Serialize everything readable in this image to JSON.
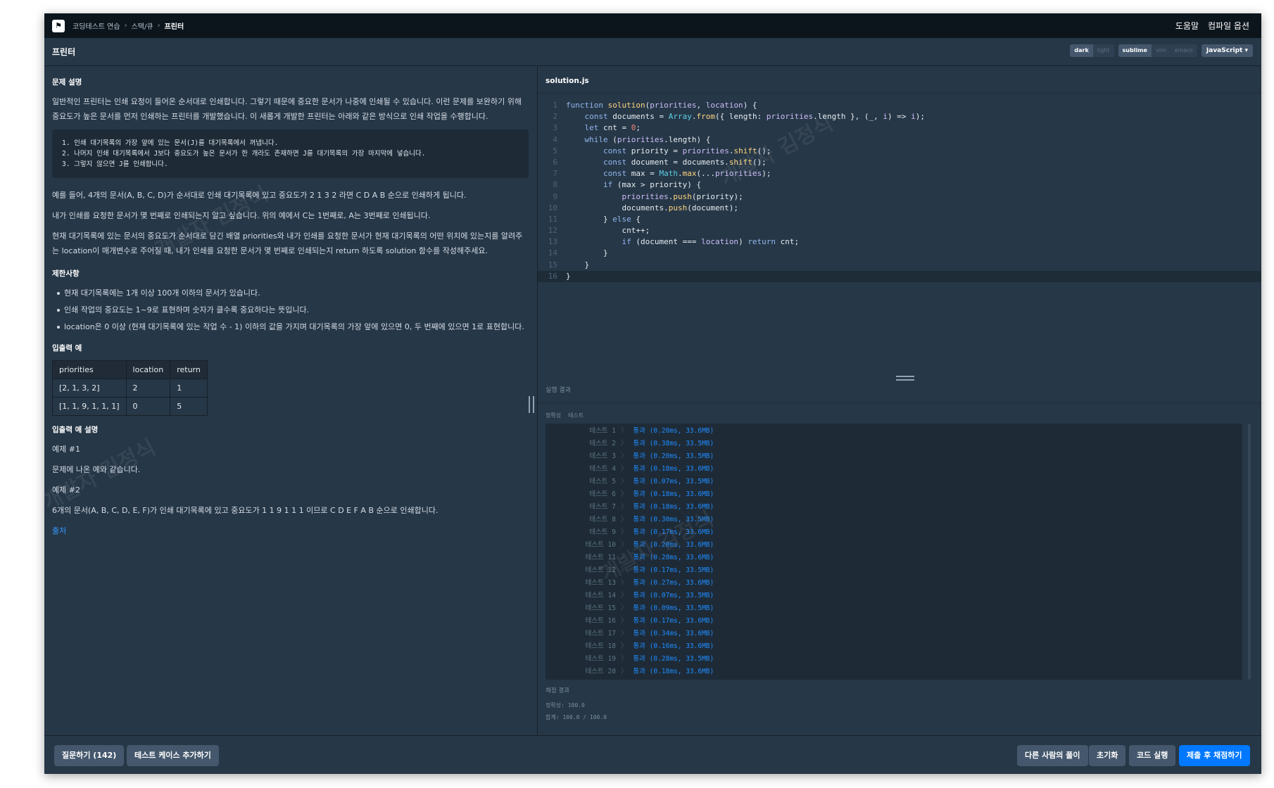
{
  "nav": {
    "logo_glyph": "⚑",
    "breadcrumb": [
      "코딩테스트 연습",
      "스택/큐",
      "프린터"
    ],
    "help": "도움말",
    "compile_options": "컴파일 옵션"
  },
  "title": "프린터",
  "editor_options": {
    "theme": [
      "dark",
      "light"
    ],
    "keymap": [
      "sublime",
      "vim",
      "emacs"
    ],
    "language": "JavaScript ▾"
  },
  "problem": {
    "heading": "문제 설명",
    "intro": "일반적인 프린터는 인쇄 요청이 들어온 순서대로 인쇄합니다. 그렇기 때문에 중요한 문서가 나중에 인쇄될 수 있습니다. 이런 문제를 보완하기 위해 중요도가 높은 문서를 먼저 인쇄하는 프린터를 개발했습니다. 이 새롭게 개발한 프린터는 아래와 같은 방식으로 인쇄 작업을 수행합니다.",
    "steps": [
      "1. 인쇄 대기목록의 가장 앞에 있는 문서(J)를 대기목록에서 꺼냅니다.",
      "2. 나머지 인쇄 대기목록에서 J보다 중요도가 높은 문서가 한 개라도 존재하면 J를 대기목록의 가장 마지막에 넣습니다.",
      "3. 그렇지 않으면 J를 인쇄합니다."
    ],
    "p1": "예를 들어, 4개의 문서(A, B, C, D)가 순서대로 인쇄 대기목록에 있고 중요도가 2 1 3 2 라면 C D A B 순으로 인쇄하게 됩니다.",
    "p2": "내가 인쇄를 요청한 문서가 몇 번째로 인쇄되는지 알고 싶습니다. 위의 예에서 C는 1번째로, A는 3번째로 인쇄됩니다.",
    "p3": "현재 대기목록에 있는 문서의 중요도가 순서대로 담긴 배열 priorities와 내가 인쇄를 요청한 문서가 현재 대기목록의 어떤 위치에 있는지를 알려주는 location이 매개변수로 주어질 때, 내가 인쇄를 요청한 문서가 몇 번째로 인쇄되는지 return 하도록 solution 함수를 작성해주세요.",
    "constraints_heading": "제한사항",
    "constraints": [
      "현재 대기목록에는 1개 이상 100개 이하의 문서가 있습니다.",
      "인쇄 작업의 중요도는 1~9로 표현하며 숫자가 클수록 중요하다는 뜻입니다.",
      "location은 0 이상 (현재 대기목록에 있는 작업 수 - 1) 이하의 값을 가지며 대기목록의 가장 앞에 있으면 0, 두 번째에 있으면 1로 표현합니다."
    ],
    "io_heading": "입출력 예",
    "io_table": {
      "headers": [
        "priorities",
        "location",
        "return"
      ],
      "rows": [
        [
          "[2, 1, 3, 2]",
          "2",
          "1"
        ],
        [
          "[1, 1, 9, 1, 1, 1]",
          "0",
          "5"
        ]
      ]
    },
    "io_desc_heading": "입출력 예 설명",
    "ex1_label": "예제 #1",
    "ex1_text": "문제에 나온 예와 같습니다.",
    "ex2_label": "예제 #2",
    "ex2_text": "6개의 문서(A, B, C, D, E, F)가 인쇄 대기목록에 있고 중요도가 1 1 9 1 1 1 이므로 C D E F A B 순으로 인쇄합니다.",
    "source_link": "출처",
    "watermark": "개발자 김정식"
  },
  "editor": {
    "filename": "solution.js",
    "lines": [
      [
        [
          "kw",
          "function "
        ],
        [
          "fn",
          "solution"
        ],
        [
          "tx",
          "("
        ],
        [
          "pm",
          "priorities"
        ],
        [
          "tx",
          ", "
        ],
        [
          "pm",
          "location"
        ],
        [
          "tx",
          ") {"
        ]
      ],
      [
        [
          "tx",
          "    "
        ],
        [
          "kw",
          "const "
        ],
        [
          "tx",
          "documents = "
        ],
        [
          "bi",
          "Array"
        ],
        [
          "tx",
          "."
        ],
        [
          "fn",
          "from"
        ],
        [
          "tx",
          "({ length: "
        ],
        [
          "pm",
          "priorities"
        ],
        [
          "tx",
          ".length }, (_, "
        ],
        [
          "pm",
          "i"
        ],
        [
          "tx",
          ") => "
        ],
        [
          "pm",
          "i"
        ],
        [
          "tx",
          ");"
        ]
      ],
      [
        [
          "tx",
          "    "
        ],
        [
          "kw",
          "let "
        ],
        [
          "tx",
          "cnt = "
        ],
        [
          "num",
          "0"
        ],
        [
          "tx",
          ";"
        ]
      ],
      [
        [
          "tx",
          "    "
        ],
        [
          "kw",
          "while "
        ],
        [
          "tx",
          "("
        ],
        [
          "pm",
          "priorities"
        ],
        [
          "tx",
          ".length) {"
        ]
      ],
      [
        [
          "tx",
          "        "
        ],
        [
          "kw",
          "const "
        ],
        [
          "tx",
          "priority = "
        ],
        [
          "pm",
          "priorities"
        ],
        [
          "tx",
          "."
        ],
        [
          "fn",
          "shift"
        ],
        [
          "tx",
          "();"
        ]
      ],
      [
        [
          "tx",
          "        "
        ],
        [
          "kw",
          "const "
        ],
        [
          "tx",
          "document = documents."
        ],
        [
          "fn",
          "shift"
        ],
        [
          "tx",
          "();"
        ]
      ],
      [
        [
          "tx",
          "        "
        ],
        [
          "kw",
          "const "
        ],
        [
          "tx",
          "max = "
        ],
        [
          "bi",
          "Math"
        ],
        [
          "tx",
          "."
        ],
        [
          "fn",
          "max"
        ],
        [
          "tx",
          "(..."
        ],
        [
          "pm",
          "priorities"
        ],
        [
          "tx",
          ");"
        ]
      ],
      [
        [
          "tx",
          "        "
        ],
        [
          "kw",
          "if "
        ],
        [
          "tx",
          "(max > priority) {"
        ]
      ],
      [
        [
          "tx",
          "            "
        ],
        [
          "pm",
          "priorities"
        ],
        [
          "tx",
          "."
        ],
        [
          "fn",
          "push"
        ],
        [
          "tx",
          "(priority);"
        ]
      ],
      [
        [
          "tx",
          "            documents."
        ],
        [
          "fn",
          "push"
        ],
        [
          "tx",
          "(document);"
        ]
      ],
      [
        [
          "tx",
          "        } "
        ],
        [
          "kw",
          "else "
        ],
        [
          "tx",
          "{"
        ]
      ],
      [
        [
          "tx",
          "            cnt++;"
        ]
      ],
      [
        [
          "tx",
          "            "
        ],
        [
          "kw",
          "if "
        ],
        [
          "tx",
          "(document === "
        ],
        [
          "pm",
          "location"
        ],
        [
          "tx",
          ") "
        ],
        [
          "kw",
          "return "
        ],
        [
          "tx",
          "cnt;"
        ]
      ],
      [
        [
          "tx",
          "        }"
        ]
      ],
      [
        [
          "tx",
          "    }"
        ]
      ],
      [
        [
          "tx",
          "}"
        ]
      ]
    ]
  },
  "results": {
    "heading": "실행 결과",
    "tabs": [
      "정확성",
      "테스트"
    ],
    "tests": [
      {
        "name": "테스트 1",
        "result": "통과 (0.20ms, 33.6MB)"
      },
      {
        "name": "테스트 2",
        "result": "통과 (0.38ms, 33.5MB)"
      },
      {
        "name": "테스트 3",
        "result": "통과 (0.20ms, 33.5MB)"
      },
      {
        "name": "테스트 4",
        "result": "통과 (0.18ms, 33.6MB)"
      },
      {
        "name": "테스트 5",
        "result": "통과 (0.07ms, 33.5MB)"
      },
      {
        "name": "테스트 6",
        "result": "통과 (0.18ms, 33.6MB)"
      },
      {
        "name": "테스트 7",
        "result": "통과 (0.18ms, 33.6MB)"
      },
      {
        "name": "테스트 8",
        "result": "통과 (0.30ms, 33.5MB)"
      },
      {
        "name": "테스트 9",
        "result": "통과 (0.17ms, 33.6MB)"
      },
      {
        "name": "테스트 10",
        "result": "통과 (0.20ms, 33.6MB)"
      },
      {
        "name": "테스트 11",
        "result": "통과 (0.28ms, 33.6MB)"
      },
      {
        "name": "테스트 12",
        "result": "통과 (0.17ms, 33.5MB)"
      },
      {
        "name": "테스트 13",
        "result": "통과 (0.27ms, 33.6MB)"
      },
      {
        "name": "테스트 14",
        "result": "통과 (0.07ms, 33.5MB)"
      },
      {
        "name": "테스트 15",
        "result": "통과 (0.09ms, 33.5MB)"
      },
      {
        "name": "테스트 16",
        "result": "통과 (0.17ms, 33.6MB)"
      },
      {
        "name": "테스트 17",
        "result": "통과 (0.34ms, 33.6MB)"
      },
      {
        "name": "테스트 18",
        "result": "통과 (0.16ms, 33.6MB)"
      },
      {
        "name": "테스트 19",
        "result": "통과 (0.28ms, 33.5MB)"
      },
      {
        "name": "테스트 20",
        "result": "통과 (0.18ms, 33.6MB)"
      }
    ],
    "grading_heading": "채점 결과",
    "accuracy": "정확성: 100.0",
    "total": "합계: 100.0 / 100.0"
  },
  "footer": {
    "ask": "질문하기 (142)",
    "add_testcase": "테스트 케이스 추가하기",
    "others": "다른 사람의 풀이",
    "reset": "초기화",
    "run": "코드 실행",
    "submit": "제출 후 채점하기"
  }
}
